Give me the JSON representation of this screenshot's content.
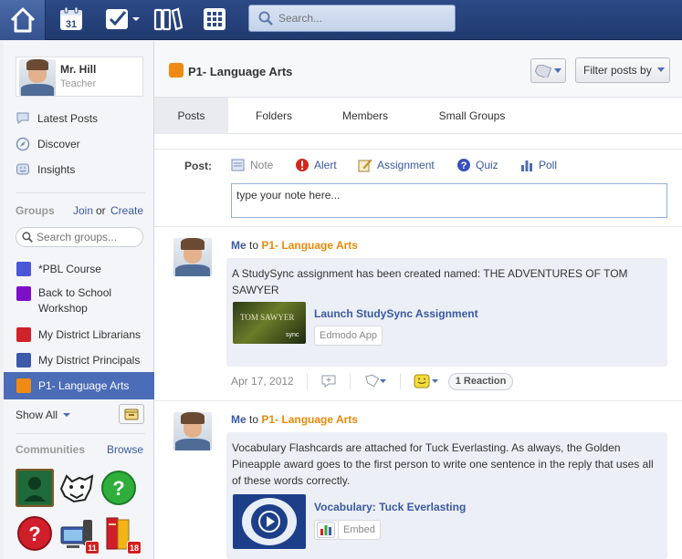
{
  "topbar": {
    "search_placeholder": "Search...",
    "calendar_day": "31",
    "icons": [
      "home-icon",
      "calendar-icon",
      "assignments-icon",
      "library-icon",
      "apps-icon"
    ]
  },
  "sidebar": {
    "profile": {
      "name": "Mr. Hill",
      "role": "Teacher"
    },
    "nav": [
      {
        "label": "Latest Posts",
        "icon": "speech-bubble-icon"
      },
      {
        "label": "Discover",
        "icon": "compass-icon"
      },
      {
        "label": "Insights",
        "icon": "insights-icon"
      }
    ],
    "groups_title": "Groups",
    "join_label": "Join",
    "or_label": "or",
    "create_label": "Create",
    "group_search_placeholder": "Search groups...",
    "groups": [
      {
        "label": "*PBL Course",
        "color": "#4a57d6"
      },
      {
        "label_line1": "Back to School",
        "label_line2": "Workshop",
        "color": "#7d0fc8"
      },
      {
        "label": "My District Librarians",
        "color": "#d0222a"
      },
      {
        "label": "My District Principals",
        "color": "#3b5aa8"
      },
      {
        "label": "P1- Language Arts",
        "color": "#ef8a12",
        "active": true
      }
    ],
    "show_all_label": "Show All",
    "communities_title": "Communities",
    "browse_label": "Browse",
    "community_badges": {
      "computer": "11",
      "books": "18"
    }
  },
  "main": {
    "header": {
      "title": "P1- Language Arts",
      "filter_label": "Filter posts by"
    },
    "tabs": [
      "Posts",
      "Folders",
      "Members",
      "Small Groups"
    ],
    "composer": {
      "post_label": "Post:",
      "types": [
        "Note",
        "Alert",
        "Assignment",
        "Quiz",
        "Poll"
      ],
      "note_value": "type your note here..."
    },
    "posts": [
      {
        "author": "Me",
        "to_label": "to",
        "group": "P1- Language Arts",
        "text": "A StudySync assignment has been created named: THE ADVENTURES OF TOM SAWYER",
        "thumb_text": "TOM SAWYER",
        "thumb_logo": "sync",
        "attachment_title": "Launch StudySync Assignment",
        "attachment_app": "Edmodo App",
        "date": "Apr 17, 2012",
        "reactions": "1 Reaction"
      },
      {
        "author": "Me",
        "to_label": "to",
        "group": "P1- Language Arts",
        "text": "Vocabulary Flashcards are attached for Tuck Everlasting. As always, the Golden Pineapple award goes to the first person to write one sentence in the reply that uses all of these words correctly.",
        "attachment_title": "Vocabulary: Tuck Everlasting",
        "attachment_app": "Embed"
      }
    ]
  }
}
